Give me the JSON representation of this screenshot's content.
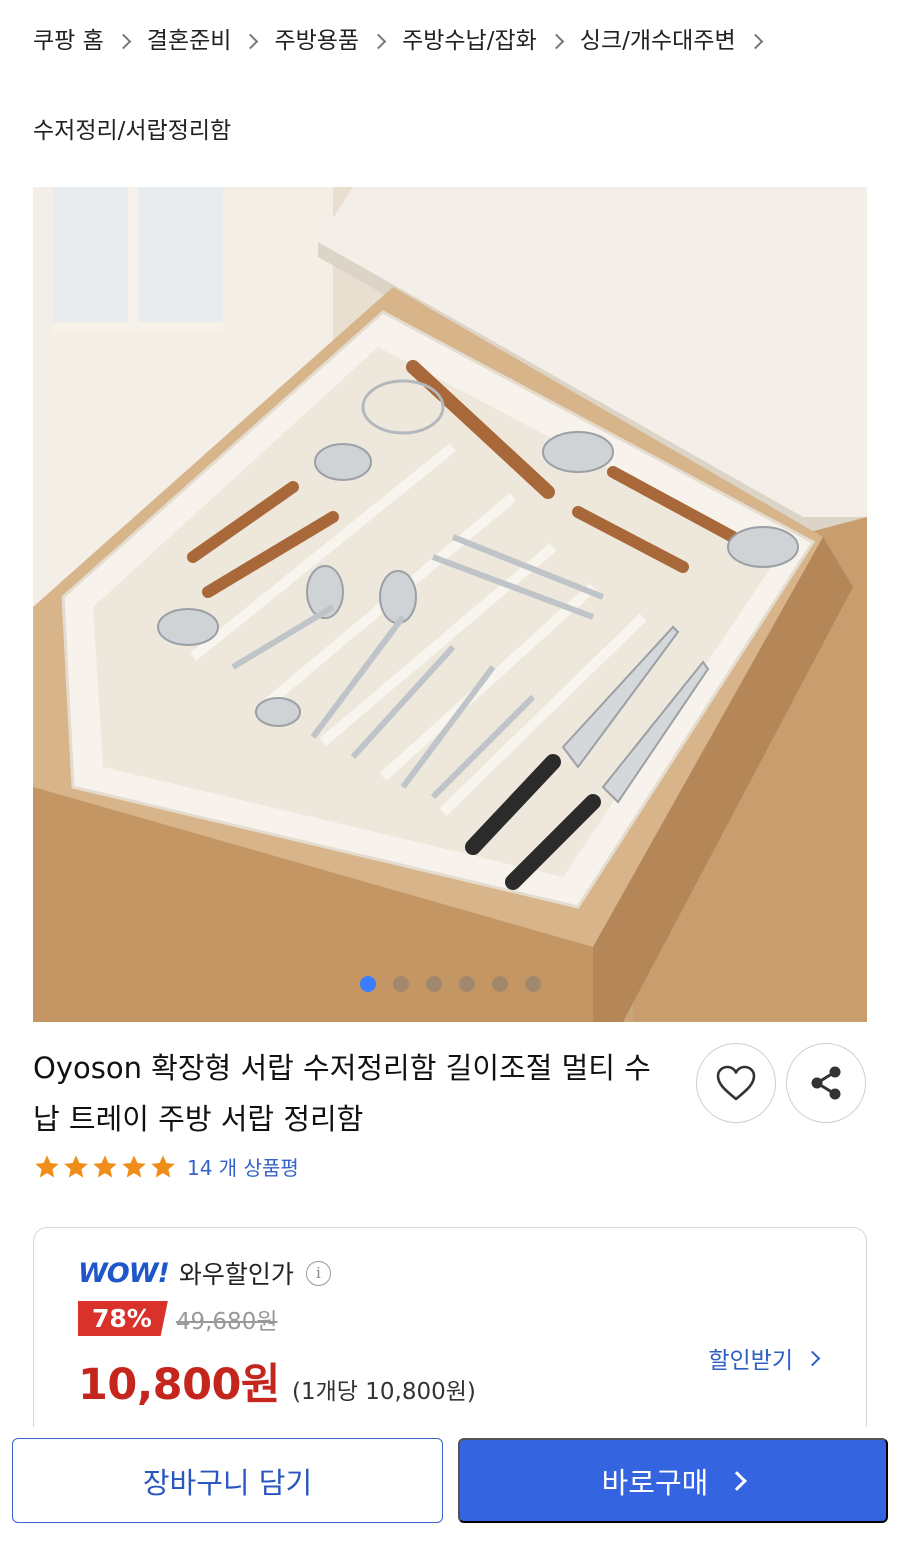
{
  "breadcrumb": {
    "items": [
      "쿠팡 홈",
      "결혼준비",
      "주방용품",
      "주방수납/잡화",
      "싱크/개수대주변",
      "수저정리/서랍정리함"
    ]
  },
  "gallery": {
    "slide_count": 6,
    "active_index": 0
  },
  "product": {
    "title": "Oyoson 확장형 서랍 수저정리함 길이조절 멀티 수납 트레이 주방 서랍 정리함",
    "rating_stars": 5,
    "review_count_text": "14 개 상품평"
  },
  "actions": {
    "wishlist_icon": "heart-icon",
    "share_icon": "share-icon"
  },
  "pricing": {
    "wow_logo": "WOW!",
    "wow_label": "와우할인가",
    "discount_rate": "78%",
    "original_price": "49,680원",
    "sale_price": "10,800원",
    "unit_price": "(1개당 10,800원)",
    "coupon_label": "할인받기"
  },
  "bottom_bar": {
    "cart_label": "장바구니 담기",
    "buy_label": "바로구매"
  },
  "colors": {
    "accent_blue": "#3464e0",
    "price_red": "#c4261d",
    "star_orange": "#f08c1a",
    "active_dot": "#3b7cff"
  }
}
